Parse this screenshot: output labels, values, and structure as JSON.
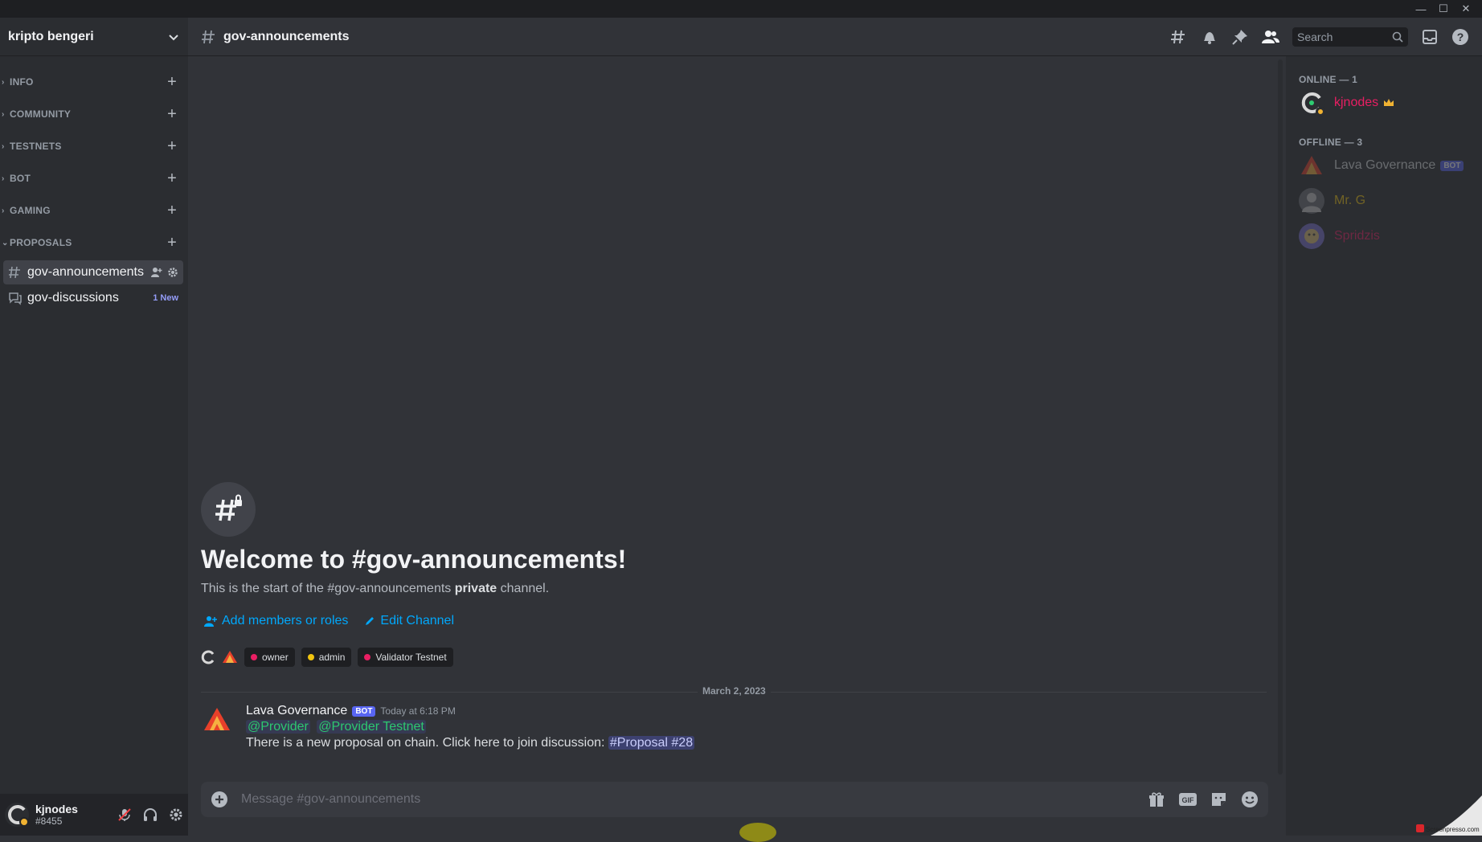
{
  "server": {
    "name": "kripto bengeri"
  },
  "categories": [
    {
      "label": "INFO"
    },
    {
      "label": "COMMUNITY"
    },
    {
      "label": "TESTNETS"
    },
    {
      "label": "BOT"
    },
    {
      "label": "GAMING"
    },
    {
      "label": "PROPOSALS"
    }
  ],
  "channels": [
    {
      "name": "gov-announcements",
      "active": true
    },
    {
      "name": "gov-discussions",
      "badge": "1 New"
    }
  ],
  "user": {
    "name": "kjnodes",
    "tag": "#8455"
  },
  "header": {
    "channel": "gov-announcements",
    "search_placeholder": "Search"
  },
  "welcome": {
    "title": "Welcome to #gov-announcements!",
    "sub_prefix": "This is the start of the #gov-announcements",
    "sub_bold": "private",
    "sub_suffix": "channel.",
    "add_members": "Add members or roles",
    "edit_channel": "Edit Channel"
  },
  "roles": [
    {
      "name": "owner",
      "color": "#e91e63"
    },
    {
      "name": "admin",
      "color": "#f1c40f"
    },
    {
      "name": "Validator Testnet",
      "color": "#e91e63"
    }
  ],
  "date_divider": "March 2, 2023",
  "message": {
    "author": "Lava Governance",
    "bot_badge": "BOT",
    "time": "Today at 6:18 PM",
    "mention1": "@Provider",
    "mention2": "@Provider Testnet",
    "text": "There is a new proposal on chain. Click here to join discussion:",
    "channel_link": "#Proposal #28"
  },
  "composer": {
    "placeholder": "Message #gov-announcements"
  },
  "members": {
    "online_label": "ONLINE — 1",
    "online": [
      {
        "name": "kjnodes",
        "color": "#e91e63"
      }
    ],
    "offline_label": "OFFLINE — 3",
    "offline": [
      {
        "name": "Lava Governance",
        "badge": "BOT",
        "color": "#dbdee1"
      },
      {
        "name": "Mr. G",
        "color": "#f1c40f"
      },
      {
        "name": "Spridzis",
        "color": "#e91e63"
      }
    ]
  },
  "brand": {
    "accent": "#5865f2",
    "link": "#00a8fc",
    "lava": "#e8402a"
  },
  "watermark": "Screenpresso.com"
}
